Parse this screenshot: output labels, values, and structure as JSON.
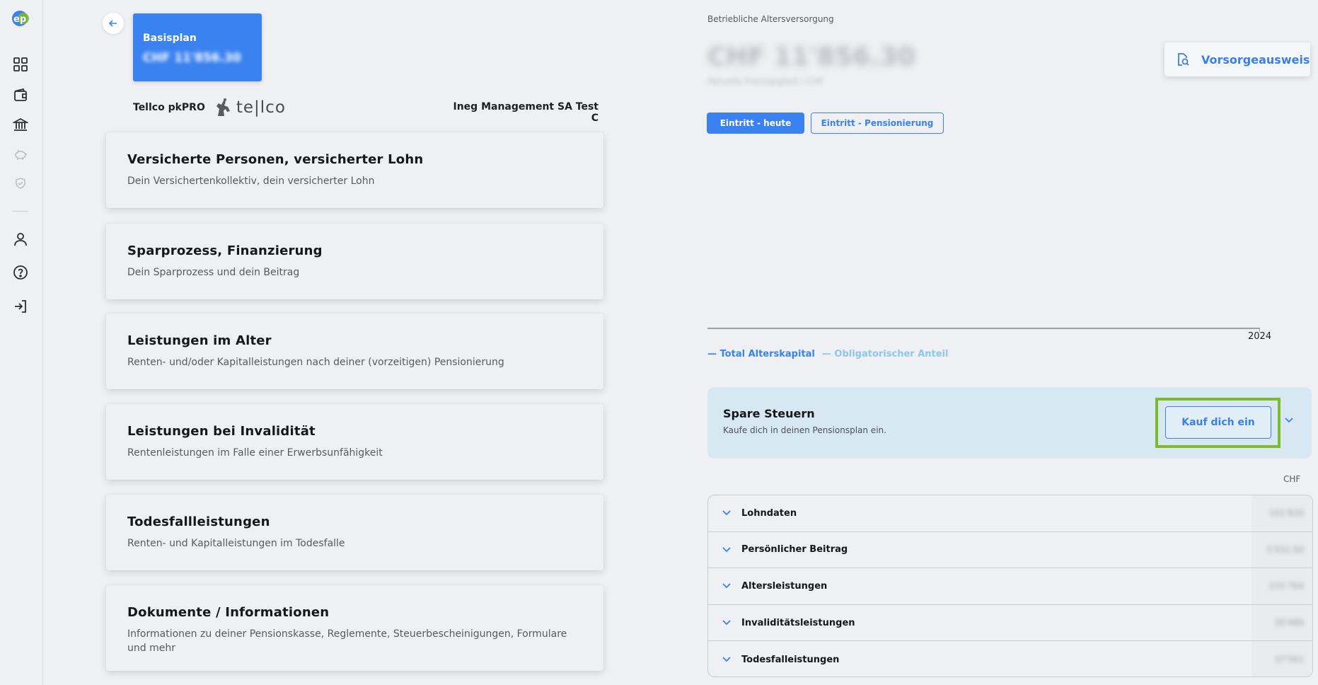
{
  "sidebar": {
    "logo_text": "ep",
    "items": [
      {
        "icon": "grid-icon"
      },
      {
        "icon": "wallet-icon"
      },
      {
        "icon": "bank-icon"
      },
      {
        "icon": "piggy-bank-icon"
      },
      {
        "icon": "shield-icon"
      },
      {
        "icon": "user-icon"
      },
      {
        "icon": "help-icon"
      },
      {
        "icon": "logout-icon"
      }
    ]
  },
  "plan": {
    "title": "Basisplan",
    "amount": "CHF 11'856.30"
  },
  "provider": {
    "name": "Tellco pkPRO",
    "logo_word": "te|lco"
  },
  "company": "Ineg Management SA Test C",
  "sections": [
    {
      "title": "Versicherte Personen, versicherter Lohn",
      "subtitle": "Dein Versichertenkollektiv, dein versicherter Lohn"
    },
    {
      "title": "Sparprozess, Finanzierung",
      "subtitle": "Dein Sparprozess und dein Beitrag"
    },
    {
      "title": "Leistungen im Alter",
      "subtitle": "Renten- und/oder Kapitalleistungen nach deiner (vorzeitigen) Pensionierung"
    },
    {
      "title": "Leistungen bei Invalidität",
      "subtitle": "Rentenleistungen im Falle einer Erwerbsunfähigkeit"
    },
    {
      "title": "Todesfallleistungen",
      "subtitle": "Renten- und Kapitalleistungen im Todesfalle"
    },
    {
      "title": "Dokumente / Informationen",
      "subtitle": "Informationen zu deiner Pensionskasse, Reglemente, Steuerbescheinigungen, Formulare und mehr"
    }
  ],
  "summary": {
    "label": "Betriebliche Altersversorgung",
    "amount": "CHF 11'856.30",
    "amount_sub": "Aktuelle Freizügigkeit / CHF",
    "vorsorge_button": "Vorsorgeausweis",
    "tabs": [
      "Eintritt - heute",
      "Eintritt - Pensionierung"
    ],
    "active_tab": 0
  },
  "chart": {
    "year_label": "2024",
    "legend_total": "— Total Alterskapital",
    "legend_oblig": "— Obligatorischer Anteil",
    "colors": {
      "total": "#3a82f0",
      "oblig": "#8cc8ea"
    }
  },
  "tax": {
    "title": "Spare Steuern",
    "subtitle": "Kaufe dich in deinen Pensionsplan ein.",
    "button": "Kauf dich ein"
  },
  "accordion": {
    "currency": "CHF",
    "rows": [
      {
        "label": "Lohndaten",
        "value": "101'820"
      },
      {
        "label": "Persönlicher Beitrag",
        "value": "5'932.00"
      },
      {
        "label": "Altersleistungen",
        "value": "231'764"
      },
      {
        "label": "Invaliditätsleistungen",
        "value": "30'489"
      },
      {
        "label": "Todesfalleistungen",
        "value": "37'561"
      }
    ]
  }
}
